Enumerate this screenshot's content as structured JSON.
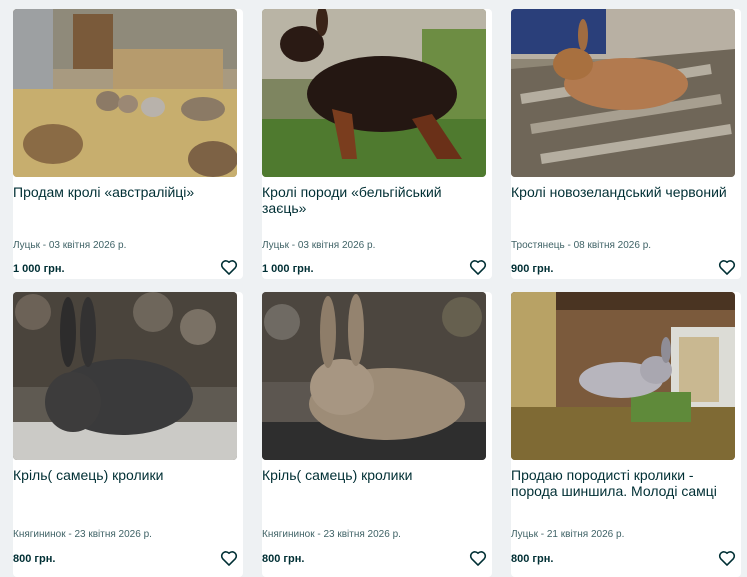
{
  "listings": [
    {
      "title": "Продам кролі «австралійці»",
      "location_date": "Луцьк - 03 квітня 2026 р.",
      "price": "1 000 грн.",
      "favorite_icon": "heart-outline-icon"
    },
    {
      "title": "Кролі породи «бельгійський заєць»",
      "location_date": "Луцьк - 03 квітня 2026 р.",
      "price": "1 000 грн.",
      "favorite_icon": "heart-outline-icon"
    },
    {
      "title": "Кролі новозеландський червоний",
      "location_date": "Тростянець - 08 квітня 2026 р.",
      "price": "900 грн.",
      "favorite_icon": "heart-outline-icon"
    },
    {
      "title": "Кріль( самець) кролики",
      "location_date": "Княгининок - 23 квітня 2026 р.",
      "price": "800 грн.",
      "favorite_icon": "heart-outline-icon"
    },
    {
      "title": "Кріль( самець) кролики",
      "location_date": "Княгининок - 23 квітня 2026 р.",
      "price": "800 грн.",
      "favorite_icon": "heart-outline-icon"
    },
    {
      "title": "Продаю породисті кролики - порода шиншила. Молоді самці",
      "location_date": "Луцьк - 21 квітня 2026 р.",
      "price": "800 грн.",
      "favorite_icon": "heart-outline-icon"
    }
  ],
  "colors": {
    "text": "#002f34",
    "meta": "#406367",
    "background": "#eef1f3",
    "card": "#ffffff"
  }
}
